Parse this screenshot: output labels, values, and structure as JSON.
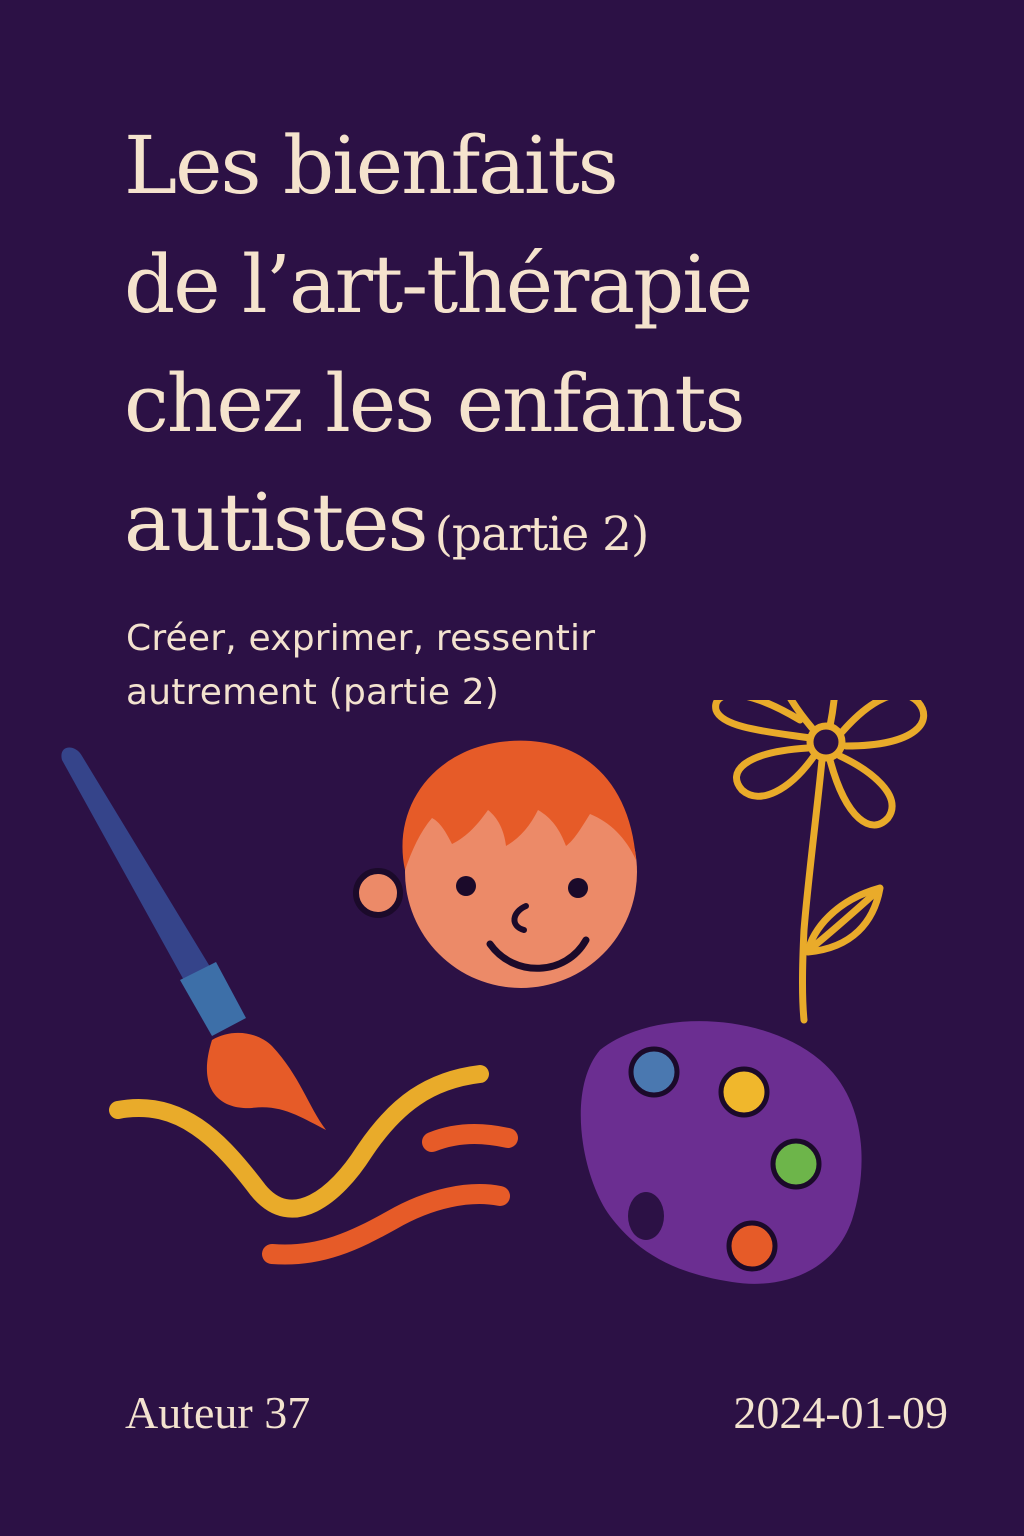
{
  "cover": {
    "title_lines": [
      "Les bienfaits",
      "de l’art-thérapie",
      "chez les enfants",
      "autistes"
    ],
    "title_part": "(partie 2)",
    "subtitle_lines": [
      "Créer, exprimer, ressentir",
      "autrement (partie 2)"
    ],
    "author": "Auteur 37",
    "date": "2024-01-09"
  },
  "colors": {
    "background": "#2c1145",
    "text": "#f5e3cd",
    "orange": "#e65b28",
    "yellow": "#e9ab2a",
    "face": "#ec8a68",
    "brush_handle": "#35448a",
    "ferrule": "#3d6fa8",
    "palette": "#6b2e91",
    "paint_blue": "#4a78b0",
    "paint_yellow": "#f0b72c",
    "paint_green": "#6db54a",
    "paint_orange": "#e65b28"
  },
  "illustrations": {
    "icons": [
      "paintbrush-icon",
      "child-face-icon",
      "flower-icon",
      "palette-icon",
      "paint-waves-icon"
    ]
  }
}
